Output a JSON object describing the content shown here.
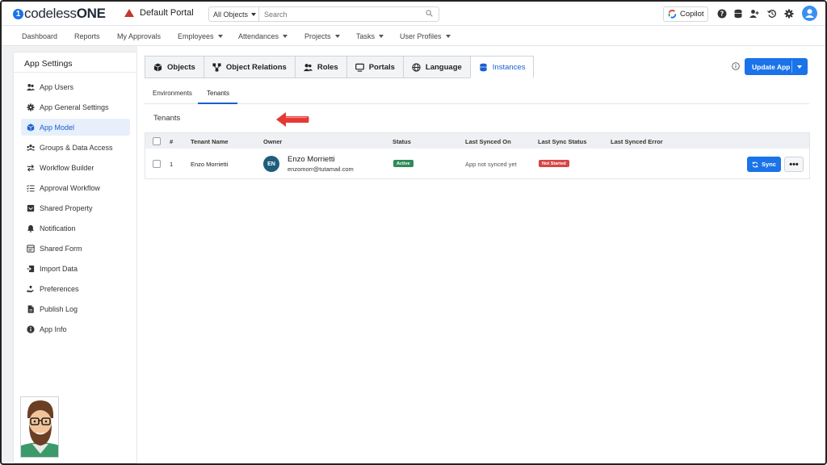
{
  "topbar": {
    "logo_badge": "1",
    "logo_main": "codeless",
    "logo_bold": "ONE",
    "portal_name": "Default Portal",
    "object_selector": "All Objects",
    "search_placeholder": "Search",
    "copilot_label": "Copilot"
  },
  "nav": {
    "items": [
      {
        "label": "Dashboard"
      },
      {
        "label": "Reports"
      },
      {
        "label": "My Approvals"
      },
      {
        "label": "Employees"
      },
      {
        "label": "Attendances"
      },
      {
        "label": "Projects"
      },
      {
        "label": "Tasks"
      },
      {
        "label": "User Profiles"
      }
    ]
  },
  "sidebar": {
    "title": "App Settings",
    "items": [
      {
        "label": "App Users",
        "icon": "users-icon"
      },
      {
        "label": "App General Settings",
        "icon": "gear-icon"
      },
      {
        "label": "App Model",
        "icon": "cube-icon"
      },
      {
        "label": "Groups & Data Access",
        "icon": "group-icon"
      },
      {
        "label": "Workflow Builder",
        "icon": "swap-arrows-icon"
      },
      {
        "label": "Approval Workflow",
        "icon": "checklist-icon"
      },
      {
        "label": "Shared Property",
        "icon": "inbox-icon"
      },
      {
        "label": "Notification",
        "icon": "bell-icon"
      },
      {
        "label": "Shared Form",
        "icon": "form-icon"
      },
      {
        "label": "Import Data",
        "icon": "import-icon"
      },
      {
        "label": "Preferences",
        "icon": "hand-heart-icon"
      },
      {
        "label": "Publish Log",
        "icon": "file-icon"
      },
      {
        "label": "App Info",
        "icon": "info-icon"
      }
    ],
    "active_index": 2
  },
  "tabs": {
    "items": [
      {
        "label": "Objects",
        "icon": "cube-icon"
      },
      {
        "label": "Object Relations",
        "icon": "relations-icon"
      },
      {
        "label": "Roles",
        "icon": "users-icon"
      },
      {
        "label": "Portals",
        "icon": "monitor-icon"
      },
      {
        "label": "Language",
        "icon": "globe-icon"
      },
      {
        "label": "Instances",
        "icon": "database-icon"
      }
    ],
    "active": "Instances",
    "update_label": "Update App"
  },
  "subtabs": {
    "items": [
      {
        "label": "Environments"
      },
      {
        "label": "Tenants"
      }
    ],
    "active": "Tenants"
  },
  "section_title": "Tenants",
  "table": {
    "columns": [
      "#",
      "Tenant Name",
      "Owner",
      "Status",
      "Last Synced On",
      "Last Sync Status",
      "Last Synced Error"
    ],
    "rows": [
      {
        "index": "1",
        "tenant_name": "Enzo Morrietti",
        "owner_initials": "EN",
        "owner_name": "Enzo Morrietti",
        "owner_email": "enzomorr@tutamail.com",
        "status": "Active",
        "last_synced_on": "App not synced yet",
        "last_sync_status": "Not Started",
        "last_synced_error": "",
        "sync_label": "Sync",
        "more_label": "•••"
      }
    ]
  },
  "colors": {
    "primary": "#1a73e8",
    "active_nav_bg": "#e6effb",
    "status_active": "#2e8b57",
    "status_not_started": "#d64545",
    "arrow": "#e53935"
  }
}
